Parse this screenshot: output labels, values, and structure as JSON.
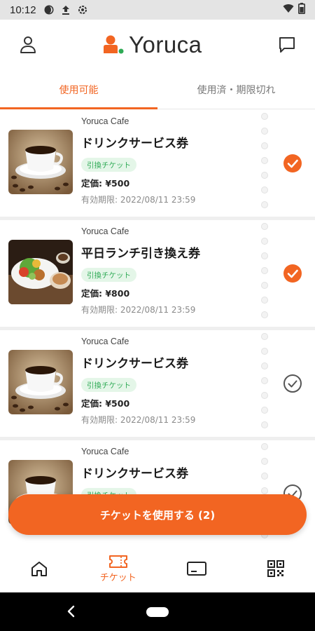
{
  "status_bar": {
    "time": "10:12",
    "icons": [
      "moon-icon",
      "upload-icon",
      "settings-icon"
    ],
    "right_icons": [
      "wifi-icon",
      "battery-icon"
    ]
  },
  "header": {
    "logo_text": "Yoruca",
    "left_icon": "user-icon",
    "right_icon": "chat-icon",
    "accent_color": "#f26522"
  },
  "tabs": [
    {
      "label": "使用可能",
      "active": true
    },
    {
      "label": "使用済・期限切れ",
      "active": false
    }
  ],
  "tickets": [
    {
      "shop": "Yoruca Cafe",
      "title": "ドリンクサービス券",
      "badge": "引換チケット",
      "price": "定価: ¥500",
      "expiry": "有効期限: 2022/08/11 23:59",
      "selected": true,
      "image": "coffee-image"
    },
    {
      "shop": "Yoruca Cafe",
      "title": "平日ランチ引き換え券",
      "badge": "引換チケット",
      "price": "定価: ¥800",
      "expiry": "有効期限: 2022/08/11 23:59",
      "selected": true,
      "image": "lunch-image"
    },
    {
      "shop": "Yoruca Cafe",
      "title": "ドリンクサービス券",
      "badge": "引換チケット",
      "price": "定価: ¥500",
      "expiry": "有効期限: 2022/08/11 23:59",
      "selected": false,
      "image": "coffee-image"
    },
    {
      "shop": "Yoruca Cafe",
      "title": "ドリンクサービス券",
      "badge": "引換チケット",
      "price": "",
      "expiry": "",
      "selected": false,
      "image": "coffee-image"
    }
  ],
  "use_button": {
    "label": "チケットを使用する (2)"
  },
  "bottom_nav": [
    {
      "icon": "home-icon",
      "label": ""
    },
    {
      "icon": "ticket-icon",
      "label": "チケット",
      "active": true
    },
    {
      "icon": "card-icon",
      "label": ""
    },
    {
      "icon": "qr-code-icon",
      "label": ""
    }
  ]
}
